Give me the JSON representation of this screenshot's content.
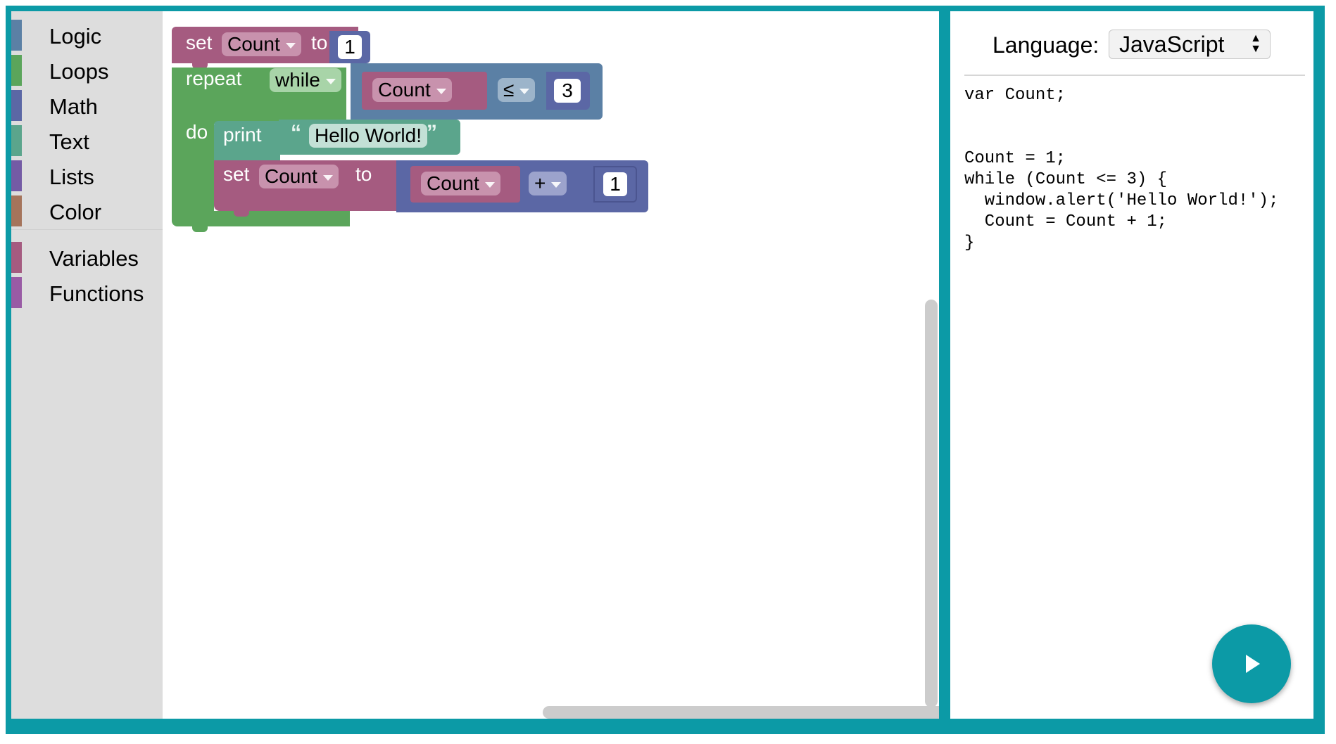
{
  "toolbox": {
    "categories": [
      {
        "label": "Logic",
        "color": "#5b80a5"
      },
      {
        "label": "Loops",
        "color": "#5ba55b"
      },
      {
        "label": "Math",
        "color": "#5b67a5"
      },
      {
        "label": "Text",
        "color": "#5ba58c"
      },
      {
        "label": "Lists",
        "color": "#745ba5"
      },
      {
        "label": "Color",
        "color": "#a5745b"
      },
      {
        "label": "Variables",
        "color": "#a55b80"
      },
      {
        "label": "Functions",
        "color": "#995ba5"
      }
    ]
  },
  "blocks": {
    "set1": {
      "keyword": "set",
      "variable": "Count",
      "to": "to",
      "value": "1"
    },
    "repeat": {
      "keyword": "repeat",
      "mode": "while",
      "do": "do",
      "compare_var": "Count",
      "operator": "≤",
      "compare_value": "3"
    },
    "print": {
      "keyword": "print",
      "open_quote": "“",
      "text": "Hello World!",
      "close_quote": "”"
    },
    "set2": {
      "keyword": "set",
      "variable": "Count",
      "to": "to",
      "lhs": "Count",
      "operator": "+",
      "rhs": "1"
    }
  },
  "colors": {
    "frame": "#0c9aa6",
    "variables": "#a55b80",
    "loops": "#5ba55b",
    "math": "#5b67a5",
    "logic": "#5b80a5",
    "text": "#5ba58c"
  },
  "code_panel": {
    "language_label": "Language:",
    "language_value": "JavaScript",
    "code": "var Count;\n\n\nCount = 1;\nwhile (Count <= 3) {\n  window.alert('Hello World!');\n  Count = Count + 1;\n}"
  },
  "icons": {
    "trash": "trash-icon",
    "run": "play-icon"
  }
}
